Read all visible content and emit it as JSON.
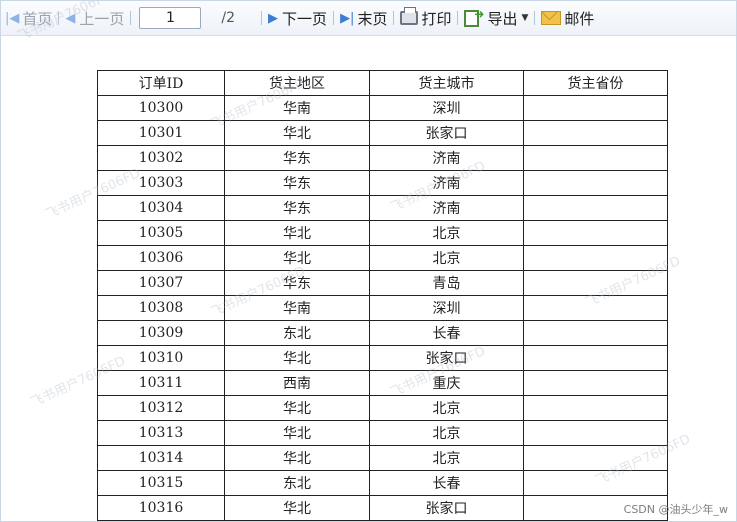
{
  "toolbar": {
    "first_page": "首页",
    "prev_page": "上一页",
    "page_value": "1",
    "page_total": "/2",
    "next_page": "下一页",
    "last_page": "末页",
    "print": "打印",
    "export": "导出",
    "mail": "邮件"
  },
  "table": {
    "headers": [
      "订单ID",
      "货主地区",
      "货主城市",
      "货主省份"
    ],
    "rows": [
      [
        "10300",
        "华南",
        "深圳",
        ""
      ],
      [
        "10301",
        "华北",
        "张家口",
        ""
      ],
      [
        "10302",
        "华东",
        "济南",
        ""
      ],
      [
        "10303",
        "华东",
        "济南",
        ""
      ],
      [
        "10304",
        "华东",
        "济南",
        ""
      ],
      [
        "10305",
        "华北",
        "北京",
        ""
      ],
      [
        "10306",
        "华北",
        "北京",
        ""
      ],
      [
        "10307",
        "华东",
        "青岛",
        ""
      ],
      [
        "10308",
        "华南",
        "深圳",
        ""
      ],
      [
        "10309",
        "东北",
        "长春",
        ""
      ],
      [
        "10310",
        "华北",
        "张家口",
        ""
      ],
      [
        "10311",
        "西南",
        "重庆",
        ""
      ],
      [
        "10312",
        "华北",
        "北京",
        ""
      ],
      [
        "10313",
        "华北",
        "北京",
        ""
      ],
      [
        "10314",
        "华北",
        "北京",
        ""
      ],
      [
        "10315",
        "东北",
        "长春",
        ""
      ],
      [
        "10316",
        "华北",
        "张家口",
        ""
      ]
    ]
  },
  "watermark": "飞书用户7606FD",
  "credit": "CSDN @油头少年_w",
  "colors": {
    "toolbar_icon": "#3b7cd6",
    "disabled_text": "#9aa3ad",
    "border": "#c9d6e6"
  }
}
